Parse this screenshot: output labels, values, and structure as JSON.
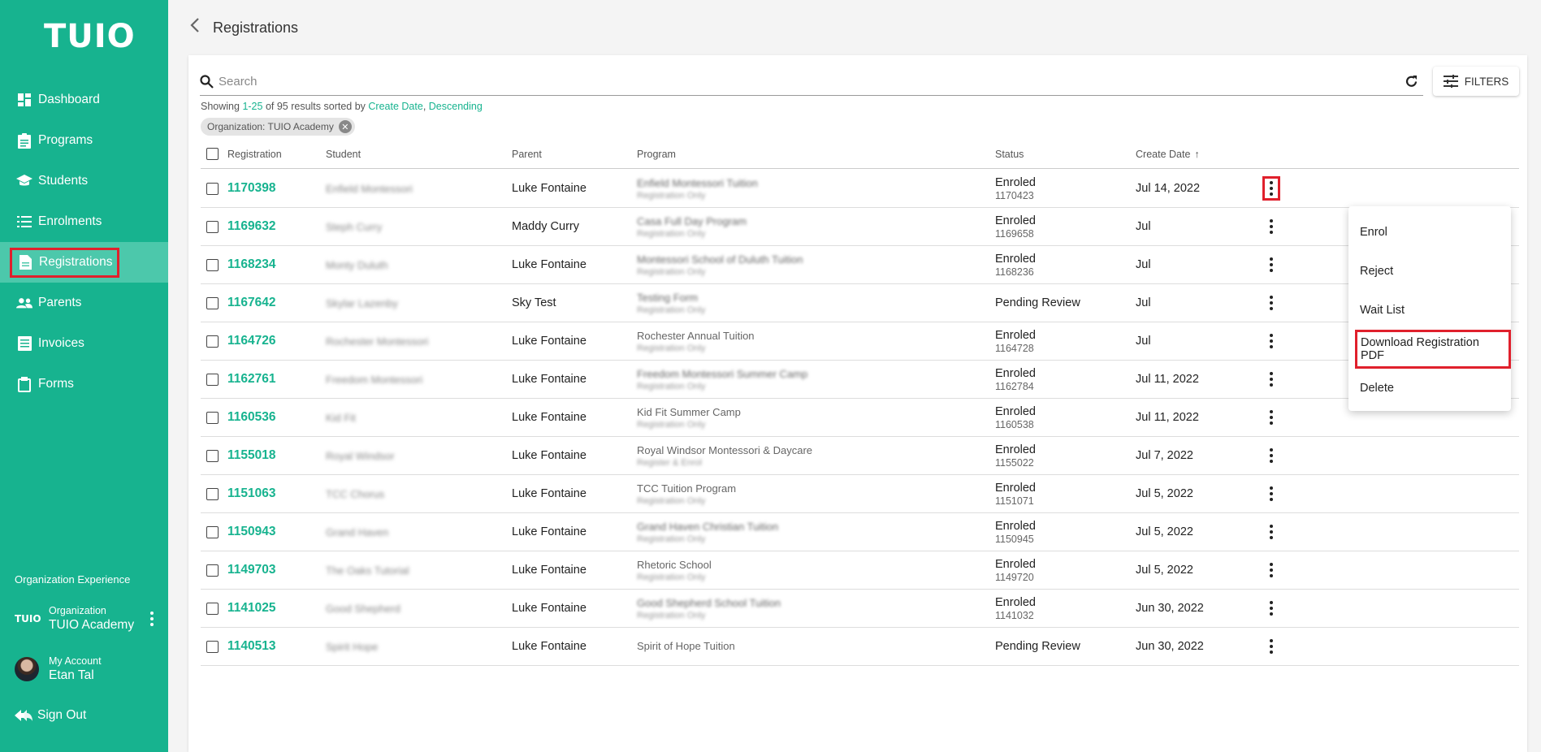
{
  "app": {
    "logo": "TUIO",
    "page_title": "Registrations"
  },
  "colors": {
    "brand": "#17b38f",
    "highlight": "#e0202c"
  },
  "sidebar": {
    "items": [
      {
        "label": "Dashboard",
        "icon": "dashboard-icon"
      },
      {
        "label": "Programs",
        "icon": "clipboard-icon"
      },
      {
        "label": "Students",
        "icon": "graduation-cap-icon"
      },
      {
        "label": "Enrolments",
        "icon": "list-icon"
      },
      {
        "label": "Registrations",
        "icon": "document-icon",
        "active": true
      },
      {
        "label": "Parents",
        "icon": "people-icon"
      },
      {
        "label": "Invoices",
        "icon": "invoice-icon"
      },
      {
        "label": "Forms",
        "icon": "clipboard-check-icon"
      }
    ],
    "org_experience": "Organization Experience",
    "org_logo": "TUIO",
    "org_label": "Organization",
    "org_name": "TUIO Academy",
    "account_label": "My Account",
    "account_name": "Etan Tal",
    "sign_out": "Sign Out"
  },
  "search": {
    "placeholder": "Search",
    "filters_label": "FILTERS"
  },
  "summary": {
    "prefix": "Showing ",
    "range": "1-25",
    "middle": " of 95 results sorted by ",
    "sort_field": "Create Date",
    "comma": ", ",
    "sort_dir": "Descending"
  },
  "chip": {
    "label": "Organization: TUIO Academy"
  },
  "table": {
    "headers": {
      "registration": "Registration",
      "student": "Student",
      "parent": "Parent",
      "program": "Program",
      "status": "Status",
      "create_date": "Create Date",
      "sort_arrow": "↑"
    },
    "rows": [
      {
        "id": "1170398",
        "student": "Enfield Montessori",
        "parent": "Luke Fontaine",
        "program": "Enfield Montessori Tuition",
        "program_sub": "Registration Only",
        "status": "Enroled",
        "status_id": "1170423",
        "date": "Jul 14, 2022"
      },
      {
        "id": "1169632",
        "student": "Steph Curry",
        "parent": "Maddy Curry",
        "program": "Casa Full Day Program",
        "program_sub": "Registration Only",
        "status": "Enroled",
        "status_id": "1169658",
        "date": "Jul"
      },
      {
        "id": "1168234",
        "student": "Monty Duluth",
        "parent": "Luke Fontaine",
        "program": "Montessori School of Duluth Tuition",
        "program_sub": "Registration Only",
        "status": "Enroled",
        "status_id": "1168236",
        "date": "Jul"
      },
      {
        "id": "1167642",
        "student": "Skylar Lazenby",
        "parent": "Sky Test",
        "program": "Testing Form",
        "program_sub": "Registration Only",
        "status": "Pending Review",
        "status_id": "",
        "date": "Jul"
      },
      {
        "id": "1164726",
        "student": "Rochester Montessori",
        "parent": "Luke Fontaine",
        "program": "Rochester Annual Tuition",
        "program_sub": "Registration Only",
        "status": "Enroled",
        "status_id": "1164728",
        "date": "Jul"
      },
      {
        "id": "1162761",
        "student": "Freedom Montessori",
        "parent": "Luke Fontaine",
        "program": "Freedom Montessori Summer Camp",
        "program_sub": "Registration Only",
        "status": "Enroled",
        "status_id": "1162784",
        "date": "Jul 11, 2022"
      },
      {
        "id": "1160536",
        "student": "Kid Fit",
        "parent": "Luke Fontaine",
        "program": "Kid Fit Summer Camp",
        "program_sub": "Registration Only",
        "status": "Enroled",
        "status_id": "1160538",
        "date": "Jul 11, 2022"
      },
      {
        "id": "1155018",
        "student": "Royal Windsor",
        "parent": "Luke Fontaine",
        "program": "Royal Windsor Montessori & Daycare",
        "program_sub": "Register & Enrol",
        "status": "Enroled",
        "status_id": "1155022",
        "date": "Jul 7, 2022"
      },
      {
        "id": "1151063",
        "student": "TCC Chorus",
        "parent": "Luke Fontaine",
        "program": "TCC Tuition Program",
        "program_sub": "Registration Only",
        "status": "Enroled",
        "status_id": "1151071",
        "date": "Jul 5, 2022"
      },
      {
        "id": "1150943",
        "student": "Grand Haven",
        "parent": "Luke Fontaine",
        "program": "Grand Haven Christian Tuition",
        "program_sub": "Registration Only",
        "status": "Enroled",
        "status_id": "1150945",
        "date": "Jul 5, 2022"
      },
      {
        "id": "1149703",
        "student": "The Oaks Tutorial",
        "parent": "Luke Fontaine",
        "program": "Rhetoric School",
        "program_sub": "Registration Only",
        "status": "Enroled",
        "status_id": "1149720",
        "date": "Jul 5, 2022"
      },
      {
        "id": "1141025",
        "student": "Good Shepherd",
        "parent": "Luke Fontaine",
        "program": "Good Shepherd School Tuition",
        "program_sub": "Registration Only",
        "status": "Enroled",
        "status_id": "1141032",
        "date": "Jun 30, 2022"
      },
      {
        "id": "1140513",
        "student": "Spirit Hope",
        "parent": "Luke Fontaine",
        "program": "Spirit of Hope Tuition",
        "program_sub": "",
        "status": "Pending Review",
        "status_id": "",
        "date": "Jun 30, 2022"
      }
    ]
  },
  "context_menu": {
    "items": [
      "Enrol",
      "Reject",
      "Wait List",
      "Download Registration PDF",
      "Delete"
    ],
    "highlighted": "Download Registration PDF"
  }
}
